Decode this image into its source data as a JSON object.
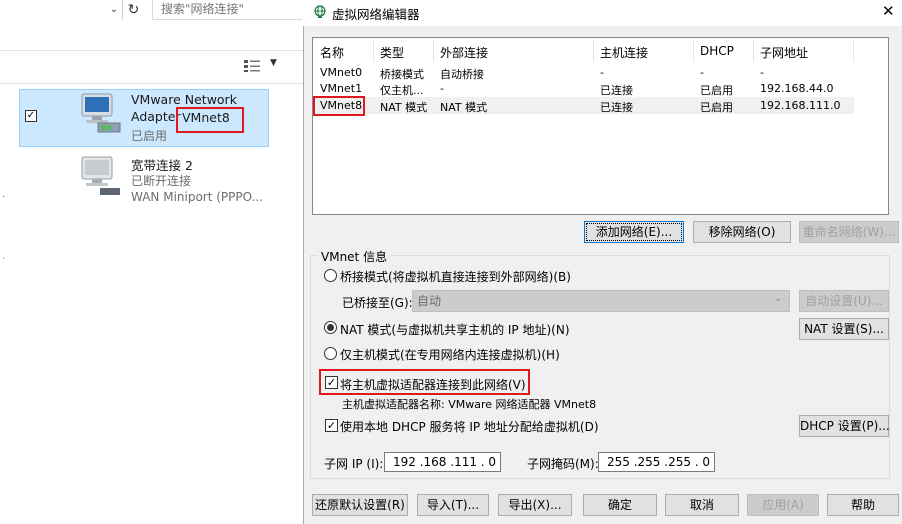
{
  "explorer": {
    "search_placeholder": "搜索\"网络连接\"",
    "refresh_icon": "↻",
    "items": [
      {
        "title": "VMware Network",
        "title2": "Adapter",
        "highlight": "VMnet8",
        "status": "已启用"
      },
      {
        "title": "宽带连接 2",
        "status": "已断开连接",
        "device": "WAN Miniport (PPPO..."
      }
    ]
  },
  "dialog": {
    "title": "虚拟网络编辑器",
    "close_label": "✕",
    "columns": [
      "名称",
      "类型",
      "外部连接",
      "主机连接",
      "DHCP",
      "子网地址"
    ],
    "rows": [
      {
        "name": "VMnet0",
        "type": "桥接模式",
        "ext": "自动桥接",
        "host": "-",
        "dhcp": "-",
        "subnet": "-"
      },
      {
        "name": "VMnet1",
        "type": "仅主机...",
        "ext": "-",
        "host": "已连接",
        "dhcp": "已启用",
        "subnet": "192.168.44.0"
      },
      {
        "name": "VMnet8",
        "type": "NAT 模式",
        "ext": "NAT 模式",
        "host": "已连接",
        "dhcp": "已启用",
        "subnet": "192.168.111.0"
      }
    ],
    "add_network": "添加网络(E)...",
    "remove_network": "移除网络(O)",
    "rename_network": "重命名网络(W)...",
    "group_label": "VMnet 信息",
    "bridge_mode": "桥接模式(将虚拟机直接连接到外部网络)(B)",
    "bridged_to_label": "已桥接至(G):",
    "bridged_to_value": "自动",
    "auto_settings": "自动设置(U)...",
    "nat_mode": "NAT 模式(与虚拟机共享主机的 IP 地址)(N)",
    "nat_settings": "NAT 设置(S)...",
    "host_only": "仅主机模式(在专用网络内连接虚拟机)(H)",
    "connect_adapter": "将主机虚拟适配器连接到此网络(V)",
    "adapter_name": "主机虚拟适配器名称: VMware 网络适配器 VMnet8",
    "use_dhcp": "使用本地 DHCP 服务将 IP 地址分配给虚拟机(D)",
    "dhcp_settings": "DHCP 设置(P)...",
    "subnet_ip_label": "子网 IP (I):",
    "subnet_ip": "192 .168 .111 . 0",
    "subnet_mask_label": "子网掩码(M):",
    "subnet_mask": "255 .255 .255 . 0",
    "restore_defaults": "还原默认设置(R)",
    "import": "导入(T)...",
    "export": "导出(X)...",
    "ok": "确定",
    "cancel": "取消",
    "apply": "应用(A)",
    "help": "帮助"
  },
  "colors": {
    "selection": "#cce8ff",
    "annotation_red": "#e0191e",
    "dialog_bg": "#f0f0f0"
  }
}
